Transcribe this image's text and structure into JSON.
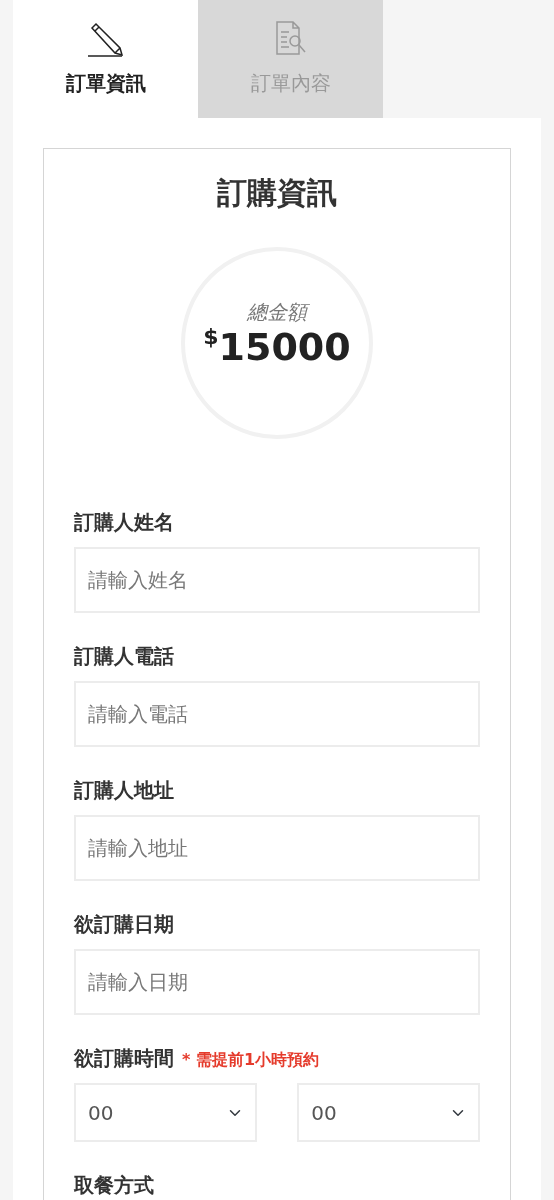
{
  "tabs": [
    {
      "label": "訂單資訊",
      "selected": true
    },
    {
      "label": "訂單內容",
      "selected": false
    }
  ],
  "card": {
    "title": "訂購資訊",
    "total": {
      "label": "總金額",
      "currency": "$",
      "amount": "15000"
    },
    "fields": [
      {
        "kind": "text",
        "label": "訂購人姓名",
        "placeholder": "請輸入姓名"
      },
      {
        "kind": "text",
        "label": "訂購人電話",
        "placeholder": "請輸入電話"
      },
      {
        "kind": "text",
        "label": "訂購人地址",
        "placeholder": "請輸入地址"
      },
      {
        "kind": "text",
        "label": "欲訂購日期",
        "placeholder": "請輸入日期"
      },
      {
        "kind": "select",
        "label": "欲訂購時間",
        "note": "* 需提前1小時預約",
        "selects": [
          {
            "value": "00"
          },
          {
            "value": "00"
          }
        ]
      },
      {
        "kind": "label",
        "label": "取餐方式"
      }
    ]
  }
}
